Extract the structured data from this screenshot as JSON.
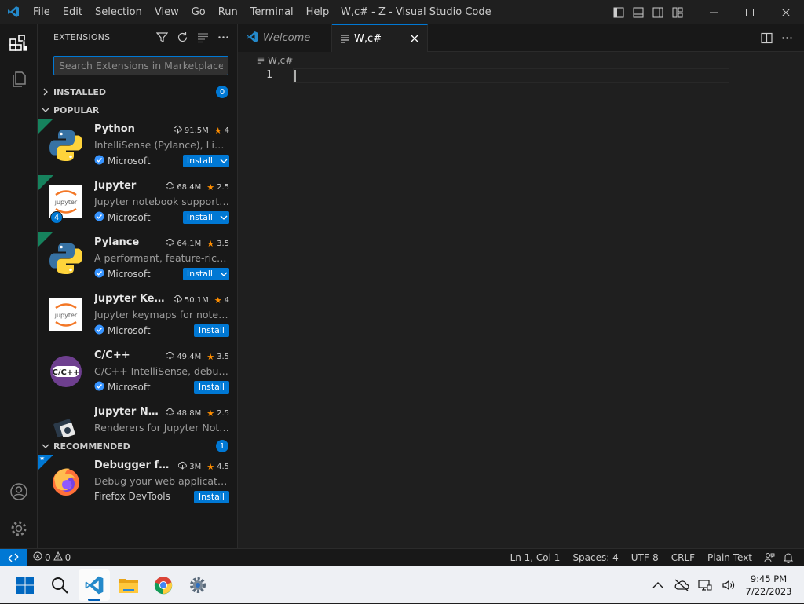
{
  "window": {
    "title": "W,c# - Z - Visual Studio Code",
    "menu": [
      "File",
      "Edit",
      "Selection",
      "View",
      "Go",
      "Run",
      "Terminal",
      "Help"
    ]
  },
  "sidebar": {
    "title": "EXTENSIONS",
    "search_placeholder": "Search Extensions in Marketplace",
    "installed": {
      "label": "INSTALLED",
      "count": "0"
    },
    "popular": {
      "label": "POPULAR",
      "items": [
        {
          "name": "Python",
          "downloads": "91.5M",
          "rating": "4",
          "description": "IntelliSense (Pylance), Linting, Debugging",
          "publisher": "Microsoft",
          "action": "Install"
        },
        {
          "name": "Jupyter",
          "downloads": "68.4M",
          "rating": "2.5",
          "description": "Jupyter notebook support, interactive programming",
          "publisher": "Microsoft",
          "action": "Install",
          "badge": "4"
        },
        {
          "name": "Pylance",
          "downloads": "64.1M",
          "rating": "3.5",
          "description": "A performant, feature-rich language server",
          "publisher": "Microsoft",
          "action": "Install"
        },
        {
          "name": "Jupyter Keymap",
          "downloads": "50.1M",
          "rating": "4",
          "description": "Jupyter keymaps for notebooks",
          "publisher": "Microsoft",
          "action": "Install"
        },
        {
          "name": "C/C++",
          "downloads": "49.4M",
          "rating": "3.5",
          "description": "C/C++ IntelliSense, debugging, and code browsing",
          "publisher": "Microsoft",
          "action": "Install"
        },
        {
          "name": "Jupyter Notebook Renderers",
          "downloads": "48.8M",
          "rating": "2.5",
          "description": "Renderers for Jupyter Notebooks",
          "publisher": "",
          "action": ""
        }
      ]
    },
    "recommended": {
      "label": "RECOMMENDED",
      "count": "1",
      "items": [
        {
          "name": "Debugger for Firefox",
          "downloads": "3M",
          "rating": "4.5",
          "description": "Debug your web application or browser extension",
          "publisher": "Firefox DevTools",
          "action": "Install"
        }
      ]
    }
  },
  "editor": {
    "tabs": [
      {
        "label": "Welcome",
        "active": false
      },
      {
        "label": "W,c#",
        "active": true
      }
    ],
    "breadcrumb": "W,c#",
    "line_number": "1"
  },
  "statusbar": {
    "errors": "0",
    "warnings": "0",
    "position": "Ln 1, Col 1",
    "spaces": "Spaces: 4",
    "encoding": "UTF-8",
    "eol": "CRLF",
    "language": "Plain Text"
  },
  "taskbar": {
    "time": "9:45 PM",
    "date": "7/22/2023"
  },
  "colors": {
    "accent": "#0078d4",
    "star": "#ff8e00",
    "badge_green": "#16825d"
  }
}
